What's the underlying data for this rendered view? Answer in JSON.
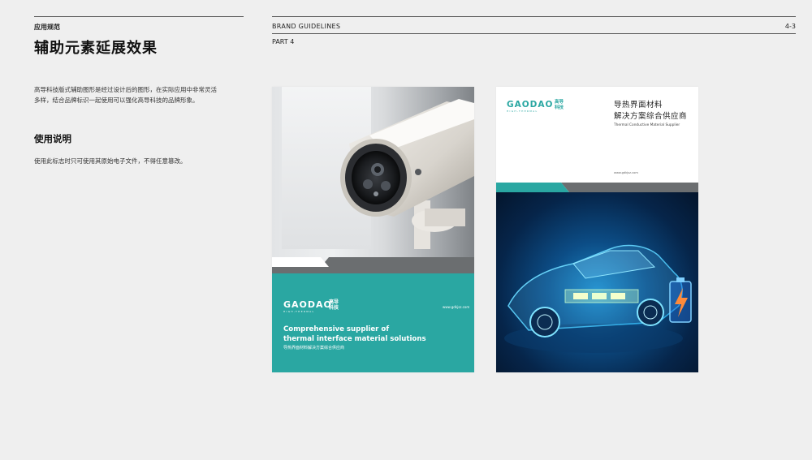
{
  "header": {
    "section_label": "应用规范",
    "page_title": "辅助元素延展效果",
    "brand_guidelines": "BRAND GUIDELINES",
    "page_number": "4-3",
    "part": "PART 4"
  },
  "content": {
    "description": "高导科技版式辅助图形是经过设计后的图形，在实际应用中非常灵活多样，结合品牌标识一起使用可以强化高导科技的品牌形象。",
    "usage_heading": "使用说明",
    "usage_text": "使用此标志时只可使用其原始电子文件，不得任意篡改。"
  },
  "card1": {
    "logo_text": "GAODAO",
    "logo_sub": "HIGH-THERMAL",
    "logo_cn_line1": "高导",
    "logo_cn_line2": "科技",
    "website": "www.gdkjsz.com",
    "tagline_line1": "Comprehensive supplier of",
    "tagline_line2": "thermal interface material solutions",
    "tagline_cn": "导热界面材料解决方案综合供应商"
  },
  "card2": {
    "logo_text": "GAODAO",
    "logo_sub": "HIGH-THERMAL",
    "logo_cn_line1": "高导",
    "logo_cn_line2": "科技",
    "headline_line1": "导热界面材料",
    "headline_line2": "解决方案综合供应商",
    "sub_en": "Thermal Conductive Material Supplier",
    "website": "www.gdkjsz.com"
  },
  "colors": {
    "brand_teal": "#2aa7a2",
    "band_grey": "#6b6e70",
    "page_bg": "#efefef"
  }
}
